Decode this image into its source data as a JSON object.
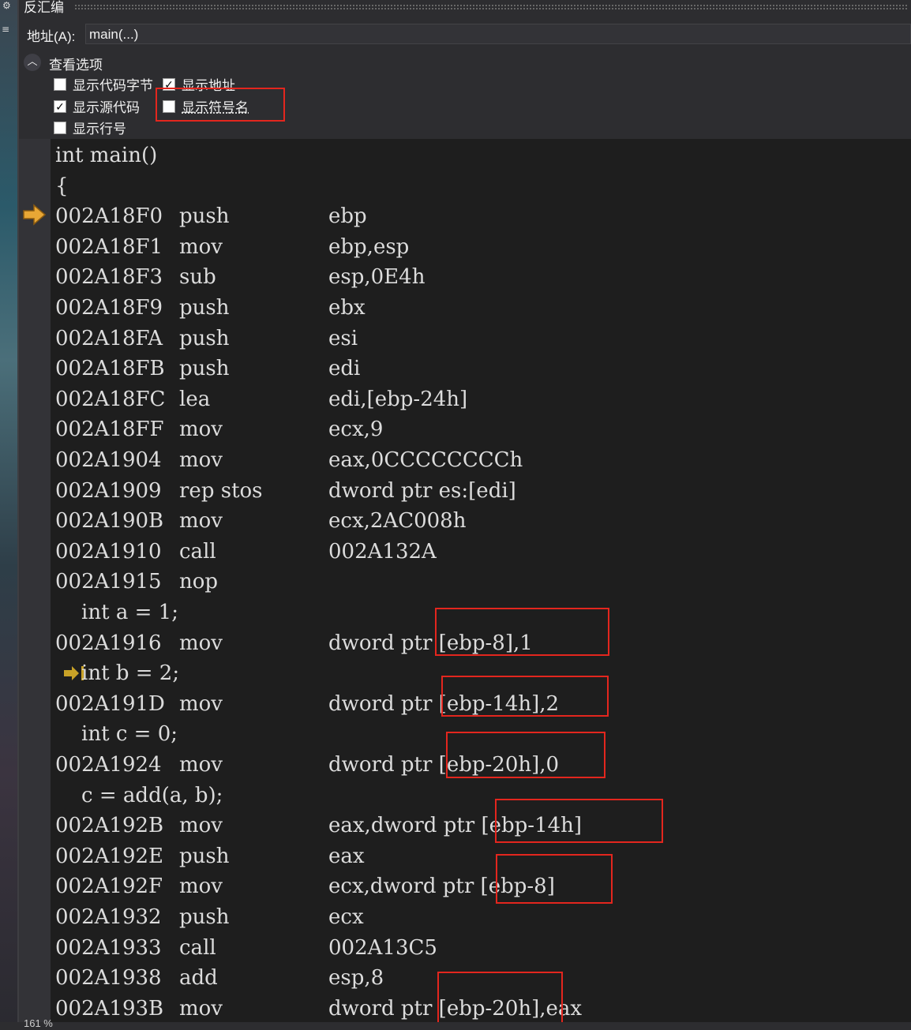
{
  "window": {
    "title": "反汇编"
  },
  "address_bar": {
    "label": "地址(A):",
    "value": "main(...)"
  },
  "options": {
    "title": "查看选项",
    "show_code_bytes": {
      "label": "显示代码字节",
      "checked": false
    },
    "show_address": {
      "label": "显示地址",
      "checked": true
    },
    "show_source": {
      "label": "显示源代码",
      "checked": true
    },
    "show_symbol_names": {
      "label": "显示符号名",
      "checked": false
    },
    "show_line_numbers": {
      "label": "显示行号",
      "checked": false
    }
  },
  "lines": [
    {
      "type": "src",
      "text": "int main()"
    },
    {
      "type": "src",
      "text": "{"
    },
    {
      "type": "asm",
      "addr": "002A18F0",
      "mn": "push",
      "op": "ebp"
    },
    {
      "type": "asm",
      "addr": "002A18F1",
      "mn": "mov",
      "op": "ebp,esp"
    },
    {
      "type": "asm",
      "addr": "002A18F3",
      "mn": "sub",
      "op": "esp,0E4h"
    },
    {
      "type": "asm",
      "addr": "002A18F9",
      "mn": "push",
      "op": "ebx"
    },
    {
      "type": "asm",
      "addr": "002A18FA",
      "mn": "push",
      "op": "esi"
    },
    {
      "type": "asm",
      "addr": "002A18FB",
      "mn": "push",
      "op": "edi"
    },
    {
      "type": "asm",
      "addr": "002A18FC",
      "mn": "lea",
      "op": "edi,[ebp-24h]"
    },
    {
      "type": "asm",
      "addr": "002A18FF",
      "mn": "mov",
      "op": "ecx,9"
    },
    {
      "type": "asm",
      "addr": "002A1904",
      "mn": "mov",
      "op": "eax,0CCCCCCCCh"
    },
    {
      "type": "asm",
      "addr": "002A1909",
      "mn": "rep stos",
      "op": "dword ptr es:[edi]"
    },
    {
      "type": "asm",
      "addr": "002A190B",
      "mn": "mov",
      "op": "ecx,2AC008h"
    },
    {
      "type": "asm",
      "addr": "002A1910",
      "mn": "call",
      "op": "002A132A"
    },
    {
      "type": "asm",
      "addr": "002A1915",
      "mn": "nop",
      "op": ""
    },
    {
      "type": "src",
      "text": "    int a = 1;"
    },
    {
      "type": "asm",
      "addr": "002A1916",
      "mn": "mov",
      "op": "dword ptr [ebp-8],1"
    },
    {
      "type": "src",
      "text": "    int b = 2;"
    },
    {
      "type": "asm",
      "addr": "002A191D",
      "mn": "mov",
      "op": "dword ptr [ebp-14h],2"
    },
    {
      "type": "src",
      "text": "    int c = 0;"
    },
    {
      "type": "asm",
      "addr": "002A1924",
      "mn": "mov",
      "op": "dword ptr [ebp-20h],0"
    },
    {
      "type": "src",
      "text": "    c = add(a, b);"
    },
    {
      "type": "asm",
      "addr": "002A192B",
      "mn": "mov",
      "op": "eax,dword ptr [ebp-14h]"
    },
    {
      "type": "asm",
      "addr": "002A192E",
      "mn": "push",
      "op": "eax"
    },
    {
      "type": "asm",
      "addr": "002A192F",
      "mn": "mov",
      "op": "ecx,dword ptr [ebp-8]"
    },
    {
      "type": "asm",
      "addr": "002A1932",
      "mn": "push",
      "op": "ecx"
    },
    {
      "type": "asm",
      "addr": "002A1933",
      "mn": "call",
      "op": "002A13C5"
    },
    {
      "type": "asm",
      "addr": "002A1938",
      "mn": "add",
      "op": "esp,8"
    },
    {
      "type": "asm",
      "addr": "002A193B",
      "mn": "mov",
      "op": "dword ptr [ebp-20h],eax"
    }
  ],
  "status": {
    "zoom": "161 %"
  },
  "colors": {
    "background": "#1e1e1e",
    "text": "#dcdcdc",
    "highlight_box": "#e3261e",
    "instruction_pointer": "#e8a735"
  }
}
